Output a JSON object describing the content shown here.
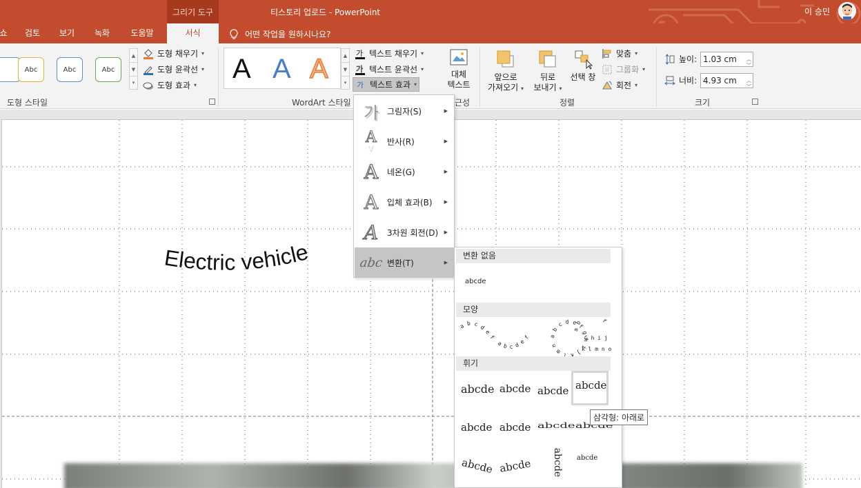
{
  "titlebar": {
    "contextual_label": "그리기 도구",
    "title": "티스토리 업로드  -  PowerPoint",
    "user": "이 승민"
  },
  "tabs": [
    {
      "label": "쇼"
    },
    {
      "label": "검토"
    },
    {
      "label": "보기"
    },
    {
      "label": "녹화"
    },
    {
      "label": "도움말"
    },
    {
      "label": "서식",
      "active": true
    }
  ],
  "tellme": "어떤 작업을 원하시나요?",
  "ribbon": {
    "shape_styles": {
      "samples": [
        "Abc",
        "Abc",
        "Abc"
      ],
      "fill": "도형 채우기",
      "outline": "도형 윤곽선",
      "effects": "도형 효과",
      "label": "도형 스타일"
    },
    "wordart": {
      "letter": "A",
      "text_fill": "텍스트 채우기",
      "text_outline": "텍스트 윤곽선",
      "text_effects": "텍스트 효과",
      "label": "WordArt 스타일"
    },
    "accessibility": {
      "alt_text": [
        "대체",
        "텍스트"
      ],
      "label_fragment": "근성"
    },
    "arrange": {
      "bring_forward": [
        "앞으로",
        "가져오기"
      ],
      "send_backward": [
        "뒤로",
        "보내기"
      ],
      "selection_pane": "선택 창",
      "align": "맞춤",
      "group": "그룹화",
      "rotate": "회전",
      "label": "정렬"
    },
    "size": {
      "height_label": "높이:",
      "height": "1.03 cm",
      "width_label": "너비:",
      "width": "4.93 cm",
      "label": "크기"
    }
  },
  "slide": {
    "wordart_text": "Electric vehicle"
  },
  "effects_menu": [
    {
      "label": "그림자(S)",
      "icon": "가"
    },
    {
      "label": "반사(R)",
      "icon": "A"
    },
    {
      "label": "네온(G)",
      "icon": "A"
    },
    {
      "label": "입체 효과(B)",
      "icon": "A"
    },
    {
      "label": "3차원 회전(D)",
      "icon": "A"
    },
    {
      "label": "변환(T)",
      "icon": "abc",
      "highlighted": true
    }
  ],
  "transform_menu": {
    "none_header": "변환 없음",
    "none_sample": "abcde",
    "shape_header": "모양",
    "warp_header": "휘기",
    "warp_sample": "abcde",
    "tooltip": "삼각형: 아래로"
  },
  "colors": {
    "accent": "#c24c2d",
    "accent_dark": "#a7391c",
    "ribbon": "#f3f3f3"
  }
}
